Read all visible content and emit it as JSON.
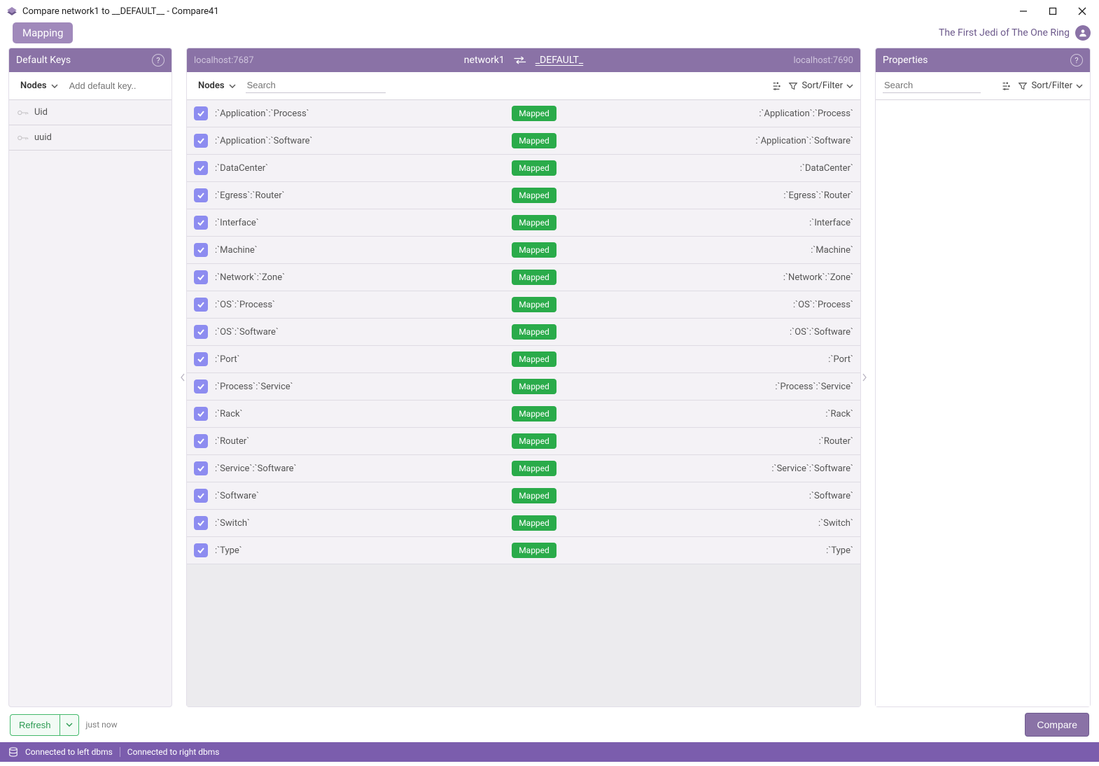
{
  "window": {
    "title": "Compare network1 to __DEFAULT__ - Compare41"
  },
  "tabs": {
    "mapping": "Mapping"
  },
  "user": {
    "name": "The First Jedi of The One Ring"
  },
  "defaultKeys": {
    "title": "Default Keys",
    "selector_label": "Nodes",
    "add_placeholder": "Add default key..",
    "items": [
      "Uid",
      "uuid"
    ]
  },
  "compare_header": {
    "left_host": "localhost:7687",
    "right_host": "localhost:7690",
    "left_db": "network1",
    "right_db": "_DEFAULT_"
  },
  "nodes_toolbar": {
    "selector_label": "Nodes",
    "search_placeholder": "Search",
    "sortfilter_label": "Sort/Filter"
  },
  "properties": {
    "title": "Properties",
    "search_placeholder": "Search",
    "sortfilter_label": "Sort/Filter"
  },
  "mappings": [
    {
      "left": ":`Application`:`Process`",
      "status": "Mapped",
      "right": ":`Application`:`Process`"
    },
    {
      "left": ":`Application`:`Software`",
      "status": "Mapped",
      "right": ":`Application`:`Software`"
    },
    {
      "left": ":`DataCenter`",
      "status": "Mapped",
      "right": ":`DataCenter`"
    },
    {
      "left": ":`Egress`:`Router`",
      "status": "Mapped",
      "right": ":`Egress`:`Router`"
    },
    {
      "left": ":`Interface`",
      "status": "Mapped",
      "right": ":`Interface`"
    },
    {
      "left": ":`Machine`",
      "status": "Mapped",
      "right": ":`Machine`"
    },
    {
      "left": ":`Network`:`Zone`",
      "status": "Mapped",
      "right": ":`Network`:`Zone`"
    },
    {
      "left": ":`OS`:`Process`",
      "status": "Mapped",
      "right": ":`OS`:`Process`"
    },
    {
      "left": ":`OS`:`Software`",
      "status": "Mapped",
      "right": ":`OS`:`Software`"
    },
    {
      "left": ":`Port`",
      "status": "Mapped",
      "right": ":`Port`"
    },
    {
      "left": ":`Process`:`Service`",
      "status": "Mapped",
      "right": ":`Process`:`Service`"
    },
    {
      "left": ":`Rack`",
      "status": "Mapped",
      "right": ":`Rack`"
    },
    {
      "left": ":`Router`",
      "status": "Mapped",
      "right": ":`Router`"
    },
    {
      "left": ":`Service`:`Software`",
      "status": "Mapped",
      "right": ":`Service`:`Software`"
    },
    {
      "left": ":`Software`",
      "status": "Mapped",
      "right": ":`Software`"
    },
    {
      "left": ":`Switch`",
      "status": "Mapped",
      "right": ":`Switch`"
    },
    {
      "left": ":`Type`",
      "status": "Mapped",
      "right": ":`Type`"
    }
  ],
  "footer": {
    "refresh_label": "Refresh",
    "timestamp": "just now",
    "compare_label": "Compare"
  },
  "statusbar": {
    "left": "Connected to left dbms",
    "right": "Connected to right dbms"
  }
}
